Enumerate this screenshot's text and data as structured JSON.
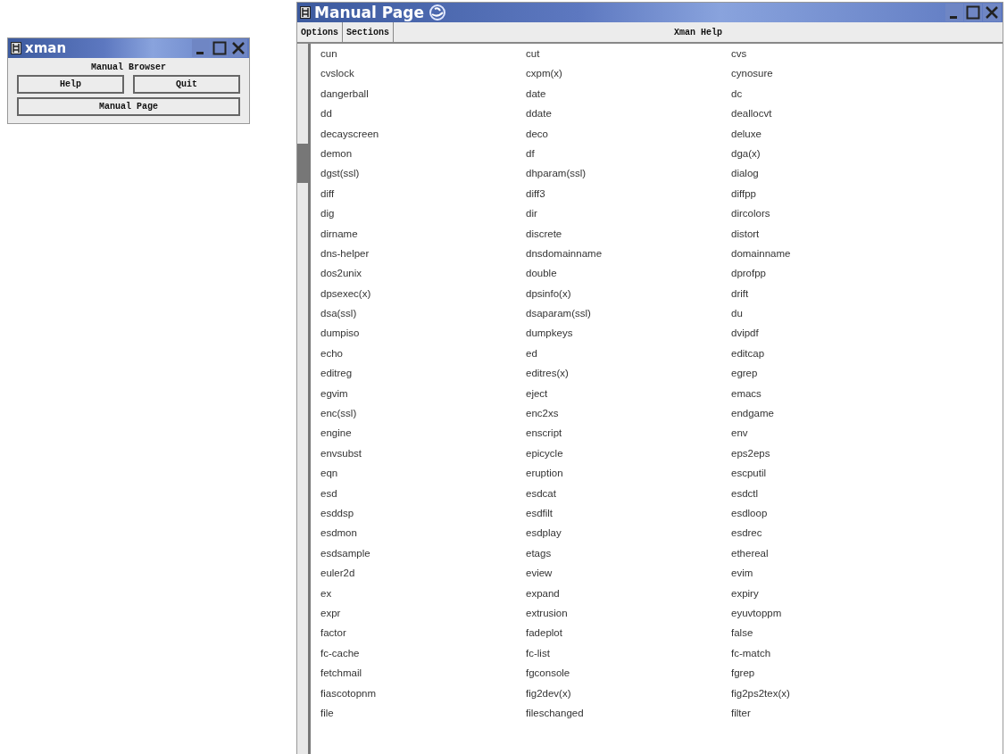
{
  "browser_window": {
    "title": "xman",
    "heading": "Manual Browser",
    "buttons": [
      "Help",
      "Quit",
      "Manual Page"
    ]
  },
  "manual_window": {
    "title": "Manual Page",
    "menus": [
      "Options",
      "Sections"
    ],
    "heading": "Xman Help",
    "rows": [
      [
        "cun",
        "cut",
        "cvs"
      ],
      [
        "cvslock",
        "cxpm(x)",
        "cynosure"
      ],
      [
        "dangerball",
        "date",
        "dc"
      ],
      [
        "dd",
        "ddate",
        "deallocvt"
      ],
      [
        "decayscreen",
        "deco",
        "deluxe"
      ],
      [
        "demon",
        "df",
        "dga(x)"
      ],
      [
        "dgst(ssl)",
        "dhparam(ssl)",
        "dialog"
      ],
      [
        "diff",
        "diff3",
        "diffpp"
      ],
      [
        "dig",
        "dir",
        "dircolors"
      ],
      [
        "dirname",
        "discrete",
        "distort"
      ],
      [
        "dns-helper",
        "dnsdomainname",
        "domainname"
      ],
      [
        "dos2unix",
        "double",
        "dprofpp"
      ],
      [
        "dpsexec(x)",
        "dpsinfo(x)",
        "drift"
      ],
      [
        "dsa(ssl)",
        "dsaparam(ssl)",
        "du"
      ],
      [
        "dumpiso",
        "dumpkeys",
        "dvipdf"
      ],
      [
        "echo",
        "ed",
        "editcap"
      ],
      [
        "editreg",
        "editres(x)",
        "egrep"
      ],
      [
        "egvim",
        "eject",
        "emacs"
      ],
      [
        "enc(ssl)",
        "enc2xs",
        "endgame"
      ],
      [
        "engine",
        "enscript",
        "env"
      ],
      [
        "envsubst",
        "epicycle",
        "eps2eps"
      ],
      [
        "eqn",
        "eruption",
        "escputil"
      ],
      [
        "esd",
        "esdcat",
        "esdctl"
      ],
      [
        "esddsp",
        "esdfilt",
        "esdloop"
      ],
      [
        "esdmon",
        "esdplay",
        "esdrec"
      ],
      [
        "esdsample",
        "etags",
        "ethereal"
      ],
      [
        "euler2d",
        "eview",
        "evim"
      ],
      [
        "ex",
        "expand",
        "expiry"
      ],
      [
        "expr",
        "extrusion",
        "eyuvtoppm"
      ],
      [
        "factor",
        "fadeplot",
        "false"
      ],
      [
        "fc-cache",
        "fc-list",
        "fc-match"
      ],
      [
        "fetchmail",
        "fgconsole",
        "fgrep"
      ],
      [
        "fiascotopnm",
        "fig2dev(x)",
        "fig2ps2tex(x)"
      ],
      [
        "file",
        "fileschanged",
        "filter"
      ]
    ]
  }
}
